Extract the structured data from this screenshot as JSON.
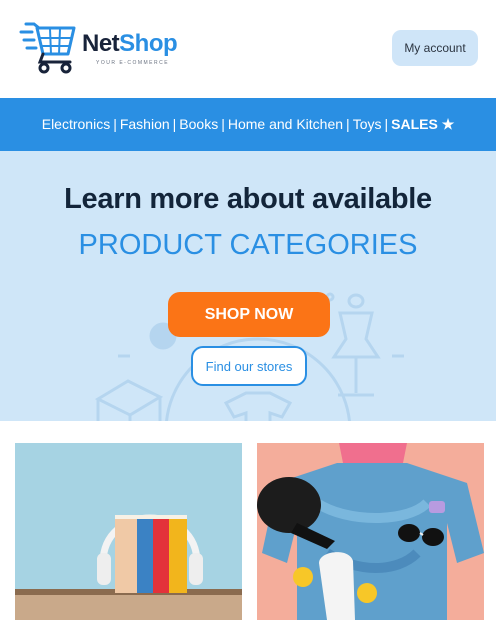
{
  "brand": {
    "name_part1": "Net",
    "name_part2": "Shop",
    "tagline": "YOUR E-COMMERCE"
  },
  "header": {
    "account_label": "My account"
  },
  "nav": {
    "items": [
      "Electronics",
      "Fashion",
      "Books",
      "Home and Kitchen",
      "Toys"
    ],
    "separator": "|",
    "sales_label": "SALES ★"
  },
  "hero": {
    "title_line1": "Learn more about available",
    "title_line2": "PRODUCT CATEGORIES",
    "shop_button": "SHOP NOW",
    "stores_button": "Find our stores"
  },
  "colors": {
    "brand_blue": "#2a8fe3",
    "hero_bg": "#cfe6f8",
    "cta_orange": "#fb7416",
    "dark_text": "#13253a"
  },
  "products": [
    {
      "image": "books-with-headphones"
    },
    {
      "image": "fashion-flatlay-skateboard"
    }
  ]
}
